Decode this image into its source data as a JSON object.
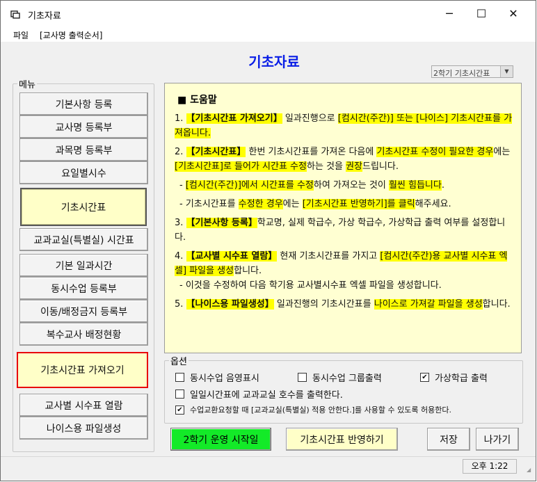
{
  "window": {
    "title": "기초자료",
    "minimize": "─",
    "maximize": "☐",
    "close": "✕"
  },
  "menu": [
    "파일",
    "[교사명 출력순서]"
  ],
  "heading": "기초자료",
  "semester_select": {
    "value": "2학기 기초시간표"
  },
  "sidebar": {
    "label": "메뉴",
    "buttons": [
      "기본사항 등록",
      "교사명 등록부",
      "과목명 등록부",
      "요일별시수",
      "기초시간표",
      "교과교실(특별실) 시간표",
      "기본 일과시간",
      "동시수업 등록부",
      "이동/배정금지 등록부",
      "복수교사 배정현황",
      "기초시간표 가져오기",
      "교사별 시수표 열람",
      "나이스용 파일생성"
    ]
  },
  "help": {
    "title": "■ 도움말",
    "p1": {
      "n": "1. ",
      "a": "【기초시간표 가져오기】",
      "b": " 일과진행으로 ",
      "c": "[컴시간(주간)] 또는 [나이스] 기초시간표를 가져옵니다."
    },
    "p2": {
      "n": "2. ",
      "a": "【기초시간표】",
      "b": " 한번 기초시간표를 가져온 다음에 ",
      "c": "기초시간표 수정이 필요한 경우",
      "d": "에는 ",
      "e": "[기초시간표]로 들어가 시간표 수정",
      "f": "하는 것을 ",
      "g": "권장",
      "h": "드립니다."
    },
    "p2a": {
      "n": "- ",
      "a": "[컴시간(주간)]에서 시간표를 수정",
      "b": "하여 가져오는 것이 ",
      "c": "훨씬 힘듭니다",
      "d": "."
    },
    "p2b": {
      "n": "- ",
      "a": "기초시간표를 ",
      "b": "수정한 경우",
      "c": "에는 ",
      "d": "[기초시간표 반영하기]를 클릭",
      "e": "해주세요."
    },
    "p3": {
      "n": "3. ",
      "a": "【기본사항 등록】",
      "b": "학교명, 실제 학급수, 가상 학급수, 가상학급 출력 여부를 설정합니다."
    },
    "p4": {
      "n": "4. ",
      "a": "【교사별 시수표 열람】",
      "b": " 현재 기초시간표를 가지고 ",
      "c": "[컴시간(주간)용 교사별 시수표 엑셀] 파일을 생성",
      "d": "합니다."
    },
    "p4a": {
      "n": "- ",
      "a": "이것을 수정하여 다음 학기용 교사별시수표 엑셀 파일을 생성합니다."
    },
    "p5": {
      "n": "5. ",
      "a": "【나이스용 파일생성】",
      "b": " 일과진행의 기초시간표를 ",
      "c": "나이스로 가져갈 파일을 생성",
      "d": "합니다."
    }
  },
  "options": {
    "label": "옵션",
    "sync_class": {
      "label": "동시수업 음영표시",
      "checked": false
    },
    "sync_group": {
      "label": "동시수업 그룹출력",
      "checked": false
    },
    "virtual_class": {
      "label": "가상학급 출력",
      "checked": true
    },
    "daily_room": {
      "label": "일일시간표에 교과교실 호수를 출력한다.",
      "checked": false
    },
    "swap_allow": {
      "label": "수업교환요청할 때 [교과교실(특별실) 적용 안한다.]를 사용할 수 있도록 허용한다.",
      "checked": true
    }
  },
  "buttons": {
    "start": "2학기 운영 시작일",
    "apply": "기초시간표 반영하기",
    "save": "저장",
    "exit": "나가기"
  },
  "status": {
    "time": "오후 1:22"
  }
}
